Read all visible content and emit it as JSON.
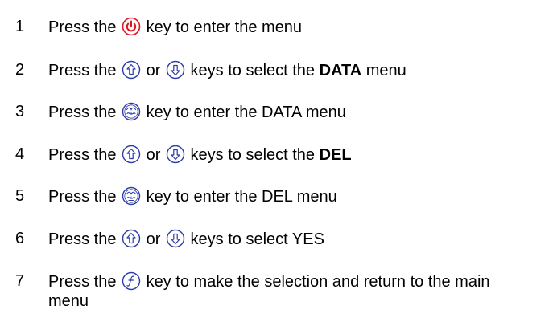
{
  "steps": [
    {
      "number": "1",
      "before": "Press the",
      "icon1": "power-key-icon",
      "after": "key to enter the menu"
    },
    {
      "number": "2",
      "before": "Press the",
      "icon1": "up-arrow-key-icon",
      "middle": "or",
      "icon2": "down-arrow-key-icon",
      "after": "keys to select the",
      "bold": "DATA",
      "tail": "menu"
    },
    {
      "number": "3",
      "before": "Press the",
      "icon1": "enter-key-icon",
      "after": "key to enter the DATA menu"
    },
    {
      "number": "4",
      "before": "Press the",
      "icon1": "up-arrow-key-icon",
      "middle": "or",
      "icon2": "down-arrow-key-icon",
      "after": "keys to select the",
      "bold": "DEL"
    },
    {
      "number": "5",
      "before": "Press the",
      "icon1": "enter-key-icon",
      "after": "key to enter the DEL menu"
    },
    {
      "number": "6",
      "before": "Press the",
      "icon1": "up-arrow-key-icon",
      "middle": "or",
      "icon2": "down-arrow-key-icon",
      "after": "keys to select YES"
    },
    {
      "number": "7",
      "before": "Press the",
      "icon1": "function-key-icon",
      "after": "key to make the selection and return to the main menu"
    }
  ],
  "colors": {
    "power_icon": "#e0141e",
    "key_icon_outline": "#2b3aa8",
    "text": "#000000"
  }
}
